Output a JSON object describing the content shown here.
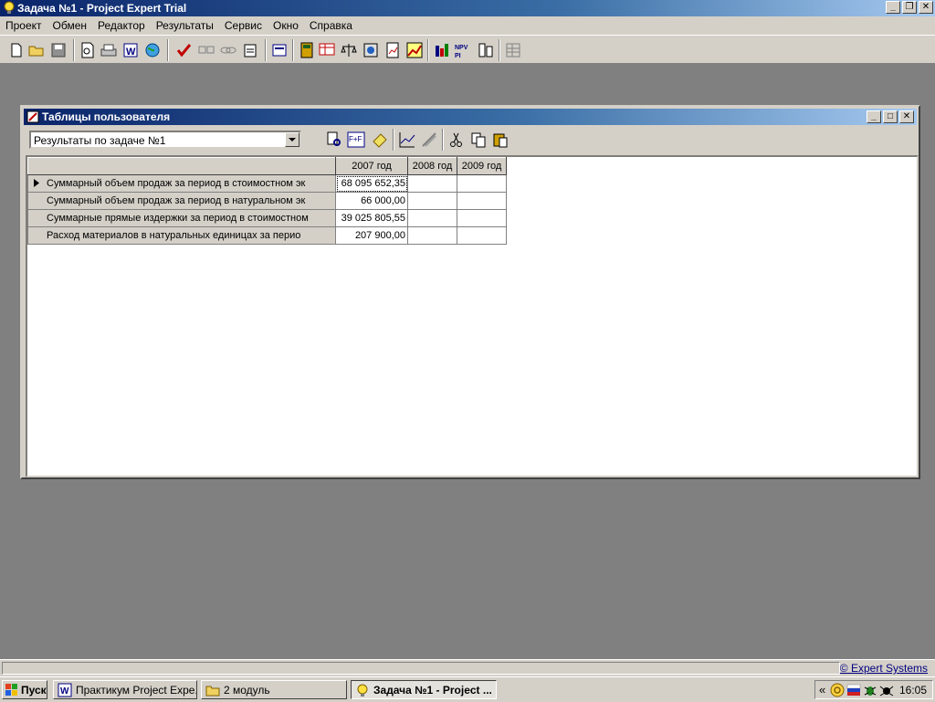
{
  "window": {
    "title": "Задача №1 - Project Expert Trial"
  },
  "menu": [
    "Проект",
    "Обмен",
    "Редактор",
    "Результаты",
    "Сервис",
    "Окно",
    "Справка"
  ],
  "child": {
    "title": "Таблицы пользователя",
    "combo_value": "Результаты по задаче №1"
  },
  "grid": {
    "columns": [
      "2007 год",
      "2008 год",
      "2009 год"
    ],
    "rows": [
      {
        "label": "Суммарный объем продаж за период в стоимостном эк",
        "values": [
          "68 095 652,35",
          "",
          ""
        ]
      },
      {
        "label": "Суммарный объем продаж за период в натуральном эк",
        "values": [
          "66 000,00",
          "",
          ""
        ]
      },
      {
        "label": "Суммарные прямые издержки за период в стоимостном",
        "values": [
          "39 025 805,55",
          "",
          ""
        ]
      },
      {
        "label": "Расход материалов в натуральных единицах за перио",
        "values": [
          "207 900,00",
          "",
          ""
        ]
      }
    ]
  },
  "status": {
    "link": "© Expert Systems"
  },
  "taskbar": {
    "start": "Пуск",
    "tasks": [
      "Практикум Project Expe...",
      "2 модуль",
      "Задача №1 - Project ..."
    ],
    "tray_chevron": "«",
    "clock": "16:05"
  },
  "icons": {
    "toolbar": [
      "new-file-icon",
      "open-folder-icon",
      "save-disk-icon",
      "print-preview-icon",
      "print-icon",
      "word-export-icon",
      "globe-icon",
      "check-icon",
      "checkbox-icon",
      "link-icon",
      "clipboard-icon",
      "project-icon",
      "calculator-icon",
      "cashflow-icon",
      "scales-icon",
      "finance-icon",
      "report-icon",
      "chart-icon",
      "table-icon",
      "npv-irr-icon",
      "building-icon",
      "grid-icon"
    ],
    "child_toolbar": [
      "search-doc-icon",
      "formula-icon",
      "eraser-icon",
      "line-chart-icon",
      "bar-chart-icon",
      "cut-icon",
      "copy-icon",
      "paste-icon"
    ]
  },
  "colors": {
    "titlebar_start": "#0a246a",
    "titlebar_end": "#a6caf0",
    "desktop": "#808080",
    "face": "#d4d0c8"
  }
}
